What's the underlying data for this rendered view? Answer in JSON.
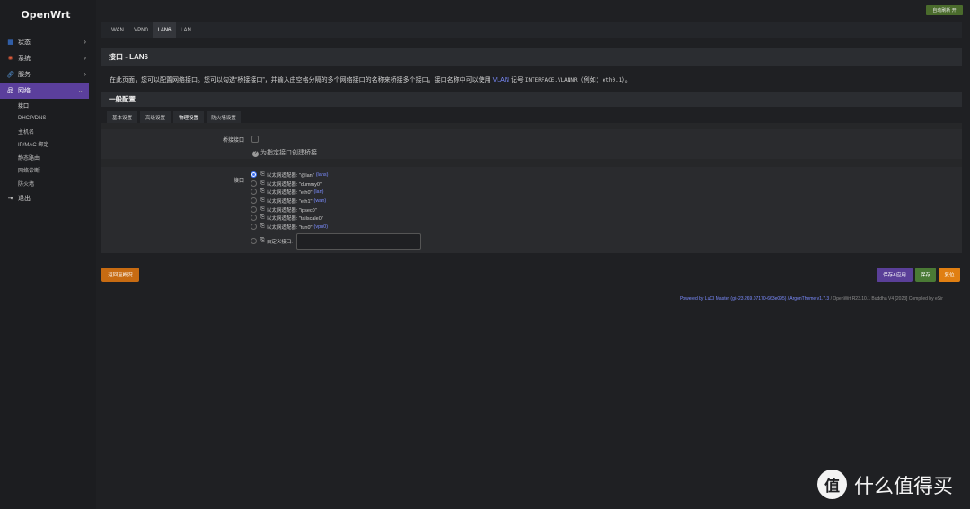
{
  "brand": "OpenWrt",
  "sidebar": {
    "items": [
      {
        "label": "状态",
        "icon": "grid-icon",
        "color": "#3d82f0"
      },
      {
        "label": "系统",
        "icon": "gear-icon",
        "color": "#e25c3a"
      },
      {
        "label": "服务",
        "icon": "link-icon",
        "color": "#5aa0e8"
      },
      {
        "label": "网络",
        "icon": "network-icon",
        "color": "#ffffff"
      }
    ],
    "sub_items": [
      "接口",
      "DHCP/DNS",
      "主机名",
      "IP/MAC 绑定",
      "静态路由",
      "网络诊断",
      "防火墙"
    ],
    "logout": "退出"
  },
  "top_button": "自动刷新 开",
  "tabs": [
    "WAN",
    "VPN0",
    "LAN6",
    "LAN"
  ],
  "page_title": "接口 - LAN6",
  "description": {
    "text1": "在此页面，您可以配置网络接口。您可以勾选“桥接接口”，并输入由空格分隔的多个网络接口的名称来桥接多个接口。接口名称中可以使用",
    "link": "VLAN",
    "text2": "记号",
    "mono1": "INTERFACE.VLANNR",
    "text3": "（例如：",
    "mono2": "eth0.1",
    "text4": "）。"
  },
  "section_title": "一般配置",
  "sub_tabs": [
    "基本设置",
    "高级设置",
    "物理设置",
    "防火墙设置"
  ],
  "bridge_label": "桥接接口",
  "bridge_help": "为指定接口创建桥接",
  "iface_label": "接口",
  "options": [
    {
      "text": "以太网适配器: \"@lan\"",
      "dev": "(lans)",
      "checked": true
    },
    {
      "text": "以太网适配器: \"dummy0\"",
      "dev": "",
      "checked": false
    },
    {
      "text": "以太网适配器: \"eth0\"",
      "dev": "(lan)",
      "checked": false
    },
    {
      "text": "以太网适配器: \"eth1\"",
      "dev": "(wan)",
      "checked": false
    },
    {
      "text": "以太网适配器: \"ipsec0\"",
      "dev": "",
      "checked": false
    },
    {
      "text": "以太网适配器: \"tailscale0\"",
      "dev": "",
      "checked": false
    },
    {
      "text": "以太网适配器: \"tun0\"",
      "dev": "(vpn0)",
      "checked": false
    }
  ],
  "custom_label": "自定义接口:",
  "buttons": {
    "back": "返回至概况",
    "save_apply": "保存&应用",
    "save": "保存",
    "reset": "复位"
  },
  "colors": {
    "back": "#c76b12",
    "save_apply": "#5a3f98",
    "save": "#4a7a35",
    "reset": "#e07f12"
  },
  "footer": {
    "part1": "Powered by LuCI Master (git-23.269.07170-663e095)",
    "part2": " / ArgonTheme v1.7.3",
    "part3": " / OpenWrt R23.10.1 Buddha V4 [2023] Compiled by eSir"
  },
  "watermark": {
    "logo": "值",
    "text": "什么值得买"
  }
}
